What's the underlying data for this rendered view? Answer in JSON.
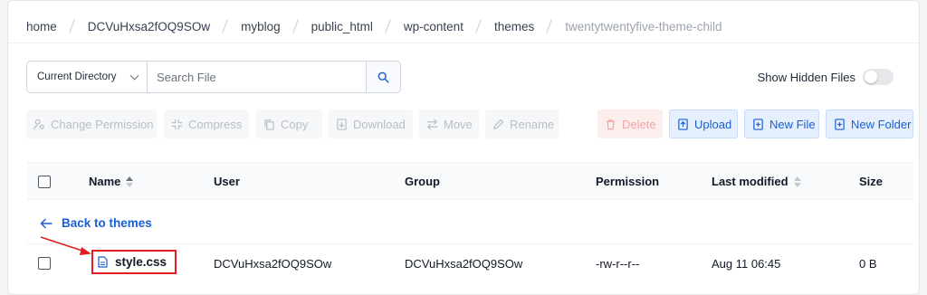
{
  "breadcrumb": [
    "home",
    "DCVuHxsa2fOQ9SOw",
    "myblog",
    "public_html",
    "wp-content",
    "themes",
    "twentytwentyfive-theme-child"
  ],
  "search": {
    "scope_label": "Current Directory",
    "placeholder": "Search File",
    "value": ""
  },
  "hidden_files": {
    "label": "Show Hidden Files",
    "enabled": false
  },
  "toolbar": {
    "change_permission": "Change Permission",
    "compress": "Compress",
    "copy": "Copy",
    "download": "Download",
    "move": "Move",
    "rename": "Rename",
    "delete": "Delete",
    "upload": "Upload",
    "new_file": "New File",
    "new_folder": "New Folder"
  },
  "table": {
    "columns": {
      "name": "Name",
      "user": "User",
      "group": "Group",
      "permission": "Permission",
      "last_modified": "Last modified",
      "size": "Size"
    },
    "back_link": "Back to themes",
    "rows": [
      {
        "name": "style.css",
        "user": "DCVuHxsa2fOQ9SOw",
        "group": "DCVuHxsa2fOQ9SOw",
        "permission": "-rw-r--r--",
        "last_modified": "Aug 11 06:45",
        "size": "0 B"
      }
    ]
  },
  "icons": {
    "search": "search-icon",
    "file": "file-icon",
    "back": "arrow-left-icon",
    "annotation": "red-arrow-annotation"
  },
  "colors": {
    "accent": "#1a5fd0",
    "danger_soft": "#fdeeee",
    "highlight": "#e11d1d"
  }
}
